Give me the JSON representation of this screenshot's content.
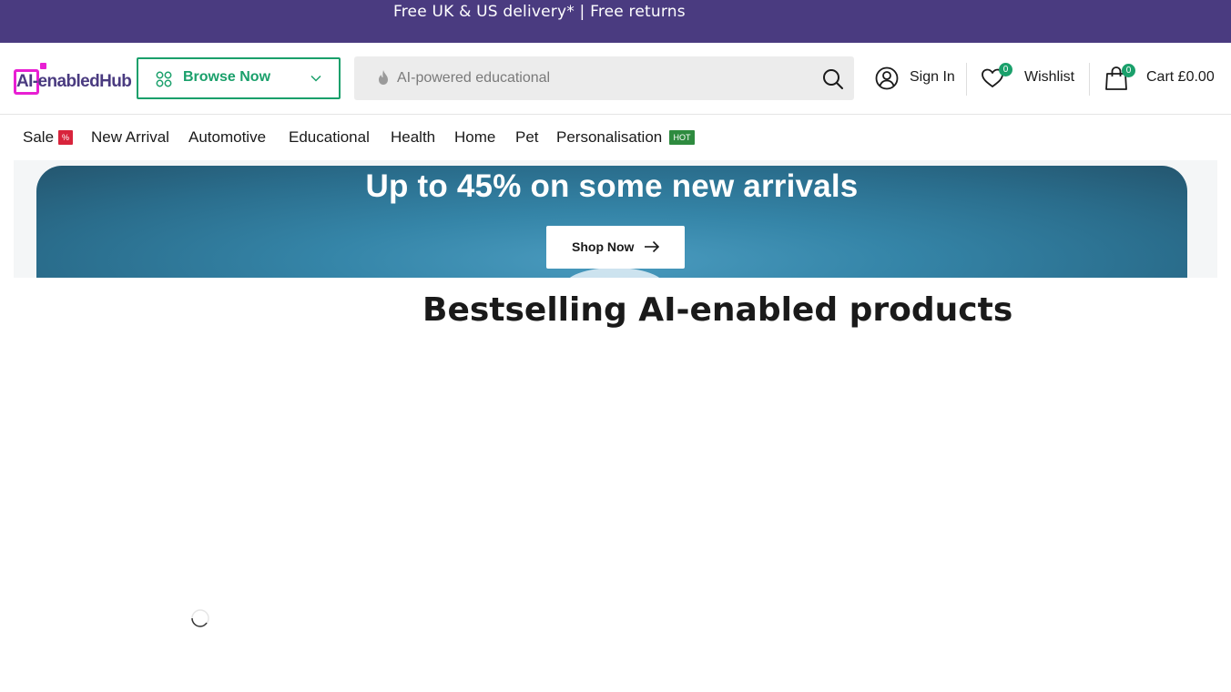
{
  "announcement": {
    "text": "Free UK & US delivery* | Free returns"
  },
  "header": {
    "logo": {
      "text": "AI-enabledHub"
    },
    "browse": {
      "label": "Browse Now"
    },
    "search": {
      "placeholder": "AI-powered educational"
    },
    "account": {
      "label": "Sign In"
    },
    "wishlist": {
      "label": "Wishlist",
      "count": "0"
    },
    "cart": {
      "label": "Cart £0.00",
      "count": "0"
    }
  },
  "nav": {
    "items": [
      {
        "label": "Sale",
        "tag": "%"
      },
      {
        "label": "New Arrival"
      },
      {
        "label": "Automotive"
      },
      {
        "label": "Educational"
      },
      {
        "label": "Health"
      },
      {
        "label": "Home"
      },
      {
        "label": "Pet"
      },
      {
        "label": "Personalisation",
        "tag": "HOT"
      }
    ]
  },
  "hero": {
    "title": "Up to 45% on some new arrivals",
    "button_label": "Shop Now"
  },
  "bestsellers": {
    "title": "Bestselling AI-enabled products"
  },
  "colors": {
    "announcement_bg": "#4a3b80",
    "accent_green": "#1aa06b",
    "logo_magenta": "#e81fd3",
    "sale_tag": "#d8243c",
    "hot_tag": "#2e8b3f"
  }
}
